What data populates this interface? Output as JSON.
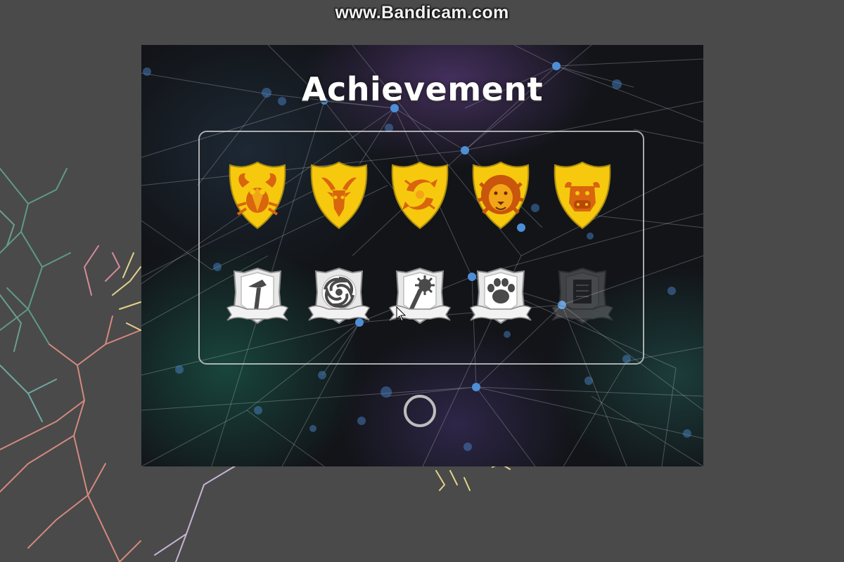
{
  "watermark": "www.Bandicam.com",
  "screen": {
    "title": "Achievement",
    "home_button_icon": "circle-icon"
  },
  "colors": {
    "shield_gold": "#f6c90e",
    "shield_symbol": "#d9650f",
    "badge_silver": "#e8e8e8",
    "panel_border": "#d8d8d8",
    "node_blue": "#4d8fd6"
  },
  "zodiac_badges": [
    {
      "icon": "crab-icon",
      "unlocked": true
    },
    {
      "icon": "goat-icon",
      "unlocked": true
    },
    {
      "icon": "fish-swirl-icon",
      "unlocked": true
    },
    {
      "icon": "lion-icon",
      "unlocked": true
    },
    {
      "icon": "bull-icon",
      "unlocked": true
    }
  ],
  "tool_badges": [
    {
      "icon": "hammer-icon",
      "unlocked": true
    },
    {
      "icon": "vortex-icon",
      "unlocked": true
    },
    {
      "icon": "mace-icon",
      "unlocked": true
    },
    {
      "icon": "paw-icon",
      "unlocked": true
    },
    {
      "icon": "scroll-icon",
      "unlocked": false
    }
  ]
}
